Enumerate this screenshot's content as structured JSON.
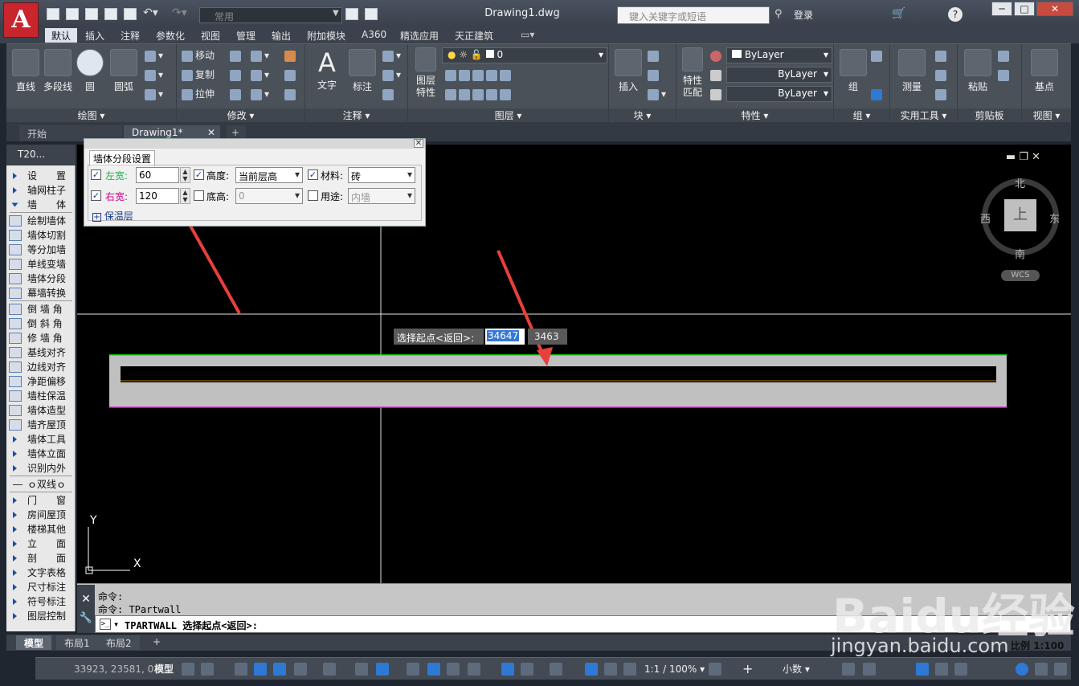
{
  "app": {
    "logo": "A",
    "doc_title": "Drawing1.dwg",
    "workspace": "常用",
    "search_placeholder": "键入关键字或短语",
    "login": "登录"
  },
  "menu_tabs": [
    "默认",
    "插入",
    "注释",
    "参数化",
    "视图",
    "管理",
    "输出",
    "附加模块",
    "A360",
    "精选应用",
    "天正建筑"
  ],
  "ribbon": {
    "draw": {
      "title": "绘图",
      "line": "直线",
      "polyline": "多段线",
      "circle": "圆",
      "arc": "圆弧"
    },
    "modify": {
      "title": "修改",
      "move": "移动",
      "copy": "复制",
      "stretch": "拉伸"
    },
    "annotate": {
      "title": "注释",
      "text": "文字",
      "dim": "标注"
    },
    "layer": {
      "title": "图层",
      "props": "图层\n特性",
      "current_layer": "0"
    },
    "block": {
      "title": "块",
      "insert": "插入"
    },
    "properties": {
      "title": "特性",
      "match": "特性\n匹配",
      "color": "ByLayer",
      "linetype": "ByLayer",
      "lineweight": "ByLayer"
    },
    "group": {
      "title": "组",
      "group": "组"
    },
    "utilities": {
      "title": "实用工具",
      "measure": "测量"
    },
    "clipboard": {
      "title": "剪贴板",
      "paste": "粘贴"
    },
    "view": {
      "title": "视图",
      "base": "基点"
    }
  },
  "doc_tabs": {
    "start": "开始",
    "drawing": "Drawing1*"
  },
  "palette": {
    "header": "T20...",
    "items": [
      {
        "label": "设　　置",
        "kind": "arrow"
      },
      {
        "label": "轴网柱子",
        "kind": "arrow"
      },
      {
        "label": "墙　　体",
        "kind": "down"
      },
      {
        "label": "绘制墙体",
        "kind": "icon"
      },
      {
        "label": "墙体切割",
        "kind": "icon"
      },
      {
        "label": "等分加墙",
        "kind": "icon"
      },
      {
        "label": "单线变墙",
        "kind": "icon"
      },
      {
        "label": "墙体分段",
        "kind": "icon"
      },
      {
        "label": "幕墙转换",
        "kind": "icon"
      },
      {
        "label": "倒 墙 角",
        "kind": "icon"
      },
      {
        "label": "倒 斜 角",
        "kind": "icon"
      },
      {
        "label": "修 墙 角",
        "kind": "icon"
      },
      {
        "label": "基线对齐",
        "kind": "icon"
      },
      {
        "label": "边线对齐",
        "kind": "icon"
      },
      {
        "label": "净距偏移",
        "kind": "icon"
      },
      {
        "label": "墙柱保温",
        "kind": "icon"
      },
      {
        "label": "墙体造型",
        "kind": "icon"
      },
      {
        "label": "墙齐屋顶",
        "kind": "icon"
      },
      {
        "label": "墙体工具",
        "kind": "arrow"
      },
      {
        "label": "墙体立面",
        "kind": "arrow"
      },
      {
        "label": "识别内外",
        "kind": "arrow"
      },
      {
        "label": "ｏ双线ｏ",
        "kind": "line"
      },
      {
        "label": "门　　窗",
        "kind": "arrow"
      },
      {
        "label": "房间屋顶",
        "kind": "arrow"
      },
      {
        "label": "楼梯其他",
        "kind": "arrow"
      },
      {
        "label": "立　　面",
        "kind": "arrow"
      },
      {
        "label": "剖　　面",
        "kind": "arrow"
      },
      {
        "label": "文字表格",
        "kind": "arrow"
      },
      {
        "label": "尺寸标注",
        "kind": "arrow"
      },
      {
        "label": "符号标注",
        "kind": "arrow"
      },
      {
        "label": "图层控制",
        "kind": "arrow"
      }
    ]
  },
  "dialog": {
    "title": "墙体分段设置",
    "left_width_label": "左宽:",
    "left_width": "60",
    "right_width_label": "右宽:",
    "right_width": "120",
    "height_label": "高度:",
    "height_value": "当前层高",
    "base_label": "底高:",
    "base_value": "0",
    "material_label": "材料:",
    "material_value": "砖",
    "usage_label": "用途:",
    "usage_value": "内墙",
    "insulation": "保温层"
  },
  "dynamic_input": {
    "prompt": "选择起点<返回>:",
    "x": "34647",
    "y": "3463"
  },
  "viewcube": {
    "north": "北",
    "south": "南",
    "east": "东",
    "west": "西",
    "top": "上",
    "wcs": "WCS"
  },
  "ucs": {
    "x": "X",
    "y": "Y"
  },
  "command": {
    "history1": "命令:",
    "history2": "命令: TPartwall",
    "current": "TPARTWALL 选择起点<返回>:"
  },
  "layout_tabs": [
    "模型",
    "布局1",
    "布局2"
  ],
  "status": {
    "coords": "33923, 23581, 0",
    "model": "模型",
    "scale": "1:1 / 100%",
    "units": "小数",
    "ratio": "比例 1:100"
  },
  "watermark": {
    "brand": "Baidu经验",
    "url": "jingyan.baidu.com"
  },
  "colors": {
    "accent": "#2e79d3",
    "wall_top": "#00ff00",
    "wall_bottom": "#ff00ff",
    "wall_fill": "#c0c0c0",
    "centerline": "#c08000",
    "annotation_arrow": "#e8403a"
  }
}
